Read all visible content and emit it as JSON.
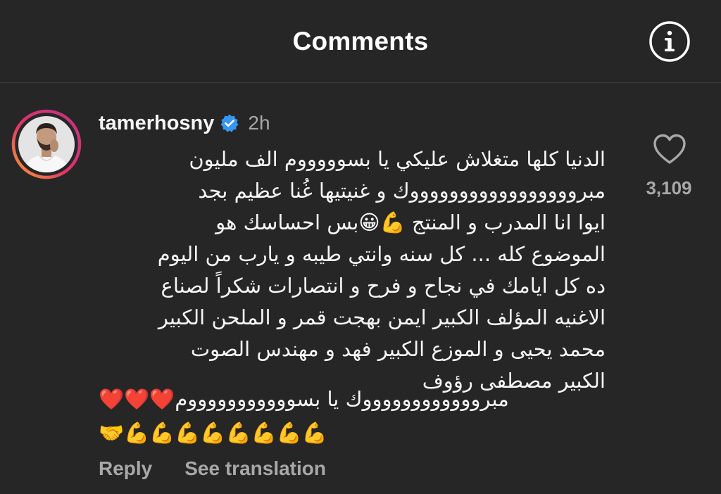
{
  "header": {
    "title": "Comments",
    "info_icon": "info-icon"
  },
  "comment": {
    "username": "tamerhosny",
    "verified_icon": "verified-badge-icon",
    "timestamp": "2h",
    "lines": [
      "الدنيا كلها متغلاش عليكي يا بسوووووم  الف مليون",
      "مبروووووووووووووووووك و غنيتيها غُنا عظيم بجد",
      "ايوا انا المدرب و المنتج 💪😀بس احساسك هو",
      "الموضوع كله ... كل سنه وانتي طيبه و يارب من اليوم",
      "ده كل ايامك في نجاح و فرح و انتصارات  شكراً لصناع",
      "الاغنيه المؤلف الكبير ايمن بهجت قمر و الملحن الكبير",
      "محمد يحيى و الموزع الكبير فهد و مهندس الصوت",
      "الكبير مصطفى رؤوف"
    ],
    "emoji_line_1": "مبرووووووووووووك يا بسوووووووووووم❤️❤️❤️",
    "emoji_line_2": "💪💪💪💪💪💪💪💪🤝",
    "like_icon": "heart-icon",
    "like_count": "3,109"
  },
  "actions": {
    "reply": "Reply",
    "see_translation": "See translation"
  },
  "colors": {
    "background": "#262626",
    "primary_text": "#f5f5f5",
    "secondary_text": "#a8a8a8",
    "verified_blue": "#3797f0"
  }
}
